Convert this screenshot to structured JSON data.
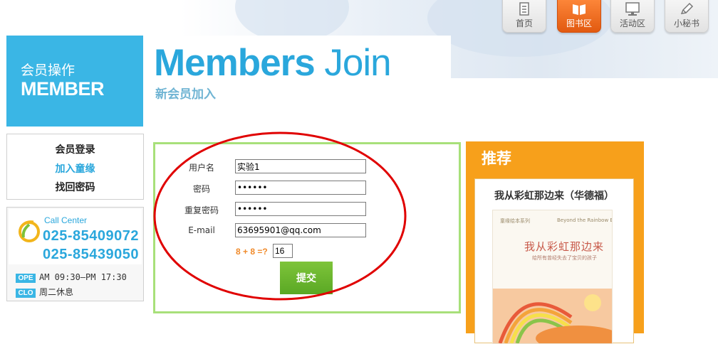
{
  "nav": {
    "items": [
      {
        "label": "首页",
        "icon": "document-icon",
        "active": false
      },
      {
        "label": "图书区",
        "icon": "book-icon",
        "active": true
      },
      {
        "label": "活动区",
        "icon": "monitor-icon",
        "active": false
      },
      {
        "label": "小秘书",
        "icon": "pencil-icon",
        "active": false
      }
    ]
  },
  "member": {
    "title_cn": "会员操作",
    "title_en": "MEMBER"
  },
  "header": {
    "title_bold": "Members",
    "title_light": " Join",
    "subtitle": "新会员加入"
  },
  "sidebar": {
    "items": [
      {
        "label": "会员登录",
        "current": false
      },
      {
        "label": "加入童缘",
        "current": true
      },
      {
        "label": "找回密码",
        "current": false
      }
    ]
  },
  "call_center": {
    "label": "Call Center",
    "phones": [
      "025-85409072",
      "025-85439050"
    ],
    "hours": [
      {
        "tag": "OPE",
        "text": "AM 09:30—PM 17:30"
      },
      {
        "tag": "CLO",
        "text": "周二休息"
      }
    ]
  },
  "form": {
    "username": {
      "label": "用户名",
      "value": "实验1"
    },
    "password": {
      "label": "密码",
      "value": "••••••"
    },
    "confirm": {
      "label": "重复密码",
      "value": "••••••"
    },
    "email": {
      "label": "E-mail",
      "value": "63695901@qq.com"
    },
    "captcha": {
      "question": "8 + 8 =?",
      "value": "16"
    },
    "submit_label": "提交"
  },
  "colors": {
    "accent": "#3ab6e5",
    "form_border": "#a8e07a",
    "recommend": "#f7a01b",
    "active_nav": "#f26a1b",
    "annotation": "#e00000"
  },
  "recommend": {
    "title": "推荐",
    "book_title": "我从彩虹那边来（华德福）",
    "cover": {
      "series": "童缘绘本系列",
      "en_title": "Beyond the Rainbow Bridge",
      "title": "我从彩虹那边来",
      "tagline": "给所有曾经失去了宝贝的孩子"
    }
  }
}
